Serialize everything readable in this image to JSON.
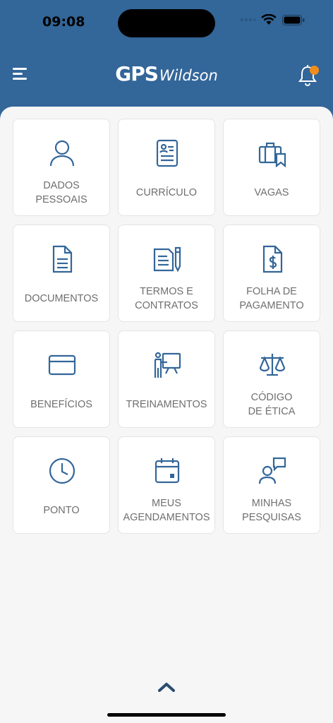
{
  "status_bar": {
    "time": "09:08"
  },
  "header": {
    "logo_gps": "GPS",
    "logo_brand": "Wildson"
  },
  "colors": {
    "primary": "#336699",
    "notification": "#f28c1c",
    "label": "#6f6f6f",
    "background": "#f6f6f6"
  },
  "tiles": [
    {
      "icon": "person-icon",
      "label": "DADOS\nPESSOAIS"
    },
    {
      "icon": "resume-icon",
      "label": "CURRÍCULO"
    },
    {
      "icon": "briefcase-icon",
      "label": "VAGAS"
    },
    {
      "icon": "document-icon",
      "label": "DOCUMENTOS"
    },
    {
      "icon": "contract-icon",
      "label": "TERMOS E\nCONTRATOS"
    },
    {
      "icon": "payroll-icon",
      "label": "FOLHA DE\nPAGAMENTO"
    },
    {
      "icon": "card-icon",
      "label": "BENEFÍCIOS"
    },
    {
      "icon": "training-icon",
      "label": "TREINAMENTOS"
    },
    {
      "icon": "scale-icon",
      "label": "CÓDIGO\nDE ÉTICA"
    },
    {
      "icon": "clock-icon",
      "label": "PONTO"
    },
    {
      "icon": "calendar-icon",
      "label": "MEUS\nAGENDAMENTOS"
    },
    {
      "icon": "survey-icon",
      "label": "MINHAS\nPESQUISAS"
    }
  ]
}
